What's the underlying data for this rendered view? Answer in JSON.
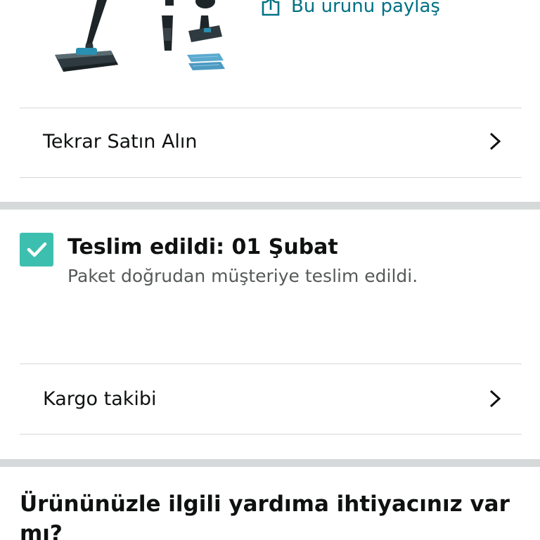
{
  "share": {
    "label": "Bu ürünü paylaş",
    "icon": "share-icon"
  },
  "rows": {
    "buy_again": "Tekrar Satın Alın",
    "tracking": "Kargo takibi"
  },
  "delivery": {
    "title": "Teslim edildi: 01 Şubat",
    "subtitle": "Paket doğrudan müşteriye teslim edildi."
  },
  "help": {
    "title": "Ürününüzle ilgili yardıma ihtiyacınız var mı?"
  },
  "colors": {
    "link": "#007185",
    "check": "#3dbfaf",
    "separator": "#d5d9d9"
  }
}
